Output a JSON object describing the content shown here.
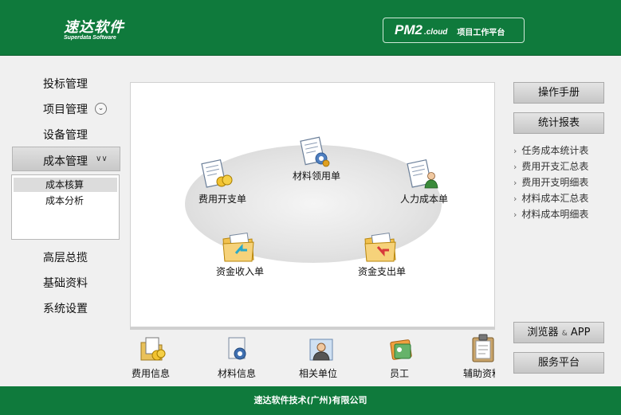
{
  "header": {
    "logo_cn": "速达软件",
    "logo_en": "Superdata Software",
    "product_name": "PM2",
    "product_suffix": ".cloud",
    "slogan": "项目工作平台",
    "bg_color": "#0f7a3c"
  },
  "nav": {
    "items": [
      {
        "label": "投标管理"
      },
      {
        "label": "项目管理"
      },
      {
        "label": "设备管理"
      },
      {
        "label": "成本管理"
      },
      {
        "label": "高层总揽"
      },
      {
        "label": "基础资料"
      },
      {
        "label": "系统设置"
      }
    ],
    "sub_items": [
      {
        "label": "成本核算",
        "selected": true
      },
      {
        "label": "成本分析",
        "selected": false
      }
    ]
  },
  "flow": {
    "nodes": [
      {
        "label": "材料领用单",
        "icon": "document-gear-icon"
      },
      {
        "label": "费用开支单",
        "icon": "document-coins-icon"
      },
      {
        "label": "人力成本单",
        "icon": "document-person-icon"
      },
      {
        "label": "资金收入单",
        "icon": "folder-arrow-in-icon"
      },
      {
        "label": "资金支出单",
        "icon": "folder-arrow-out-icon"
      }
    ]
  },
  "bottom_icons": [
    {
      "label": "费用信息",
      "icon": "expense-info-icon"
    },
    {
      "label": "材料信息",
      "icon": "material-info-icon"
    },
    {
      "label": "相关单位",
      "icon": "related-units-icon"
    },
    {
      "label": "员工",
      "icon": "employee-icon"
    },
    {
      "label": "辅助资料",
      "icon": "clipboard-icon"
    }
  ],
  "right": {
    "manual_button": "操作手册",
    "report_button": "统计报表",
    "report_links": [
      {
        "label": "任务成本统计表"
      },
      {
        "label": "费用开支汇总表"
      },
      {
        "label": "费用开支明细表"
      },
      {
        "label": "材料成本汇总表"
      },
      {
        "label": "材料成本明细表"
      }
    ],
    "browser_label": "浏览器",
    "browser_amp": "&",
    "browser_app": "APP",
    "service_button": "服务平台"
  },
  "footer": {
    "copyright": "速达软件技术(广州)有限公司"
  }
}
